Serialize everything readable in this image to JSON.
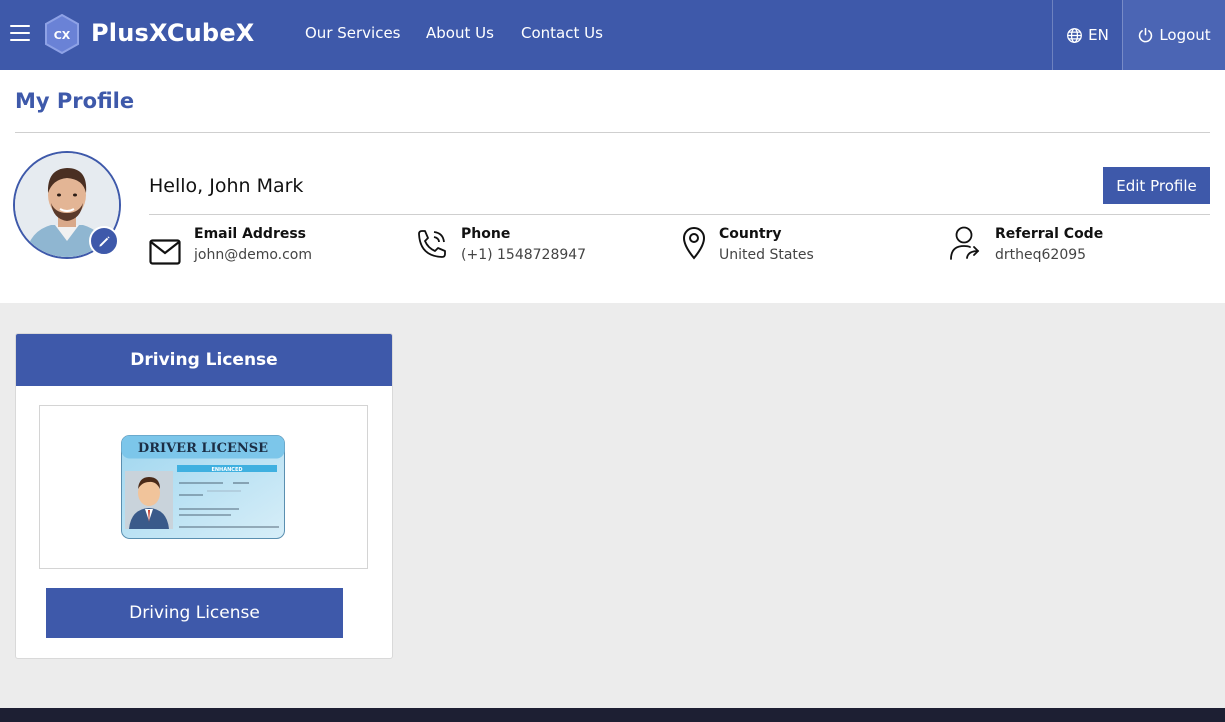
{
  "header": {
    "brand": "PlusXCubeX",
    "logo_text": "CX",
    "nav": [
      {
        "label": "Our Services"
      },
      {
        "label": "About Us"
      },
      {
        "label": "Contact Us"
      }
    ],
    "language": "EN",
    "logout": "Logout"
  },
  "profile": {
    "title": "My Profile",
    "greeting": "Hello, John Mark",
    "edit_button": "Edit Profile",
    "info": [
      {
        "label": "Email Address",
        "value": "john@demo.com",
        "icon": "envelope-icon"
      },
      {
        "label": "Phone",
        "value": "(+1) 1548728947",
        "icon": "phone-icon"
      },
      {
        "label": "Country",
        "value": "United States",
        "icon": "location-pin-icon"
      },
      {
        "label": "Referral Code",
        "value": "drtheq62095",
        "icon": "user-share-icon"
      }
    ]
  },
  "license_card": {
    "title": "Driving License",
    "image_caption": "DRIVER LICENSE",
    "image_subtitle": "ENHANCED",
    "button": "Driving License"
  },
  "colors": {
    "primary": "#3e59aa",
    "background": "#ececec",
    "footer": "#1d1f33"
  }
}
